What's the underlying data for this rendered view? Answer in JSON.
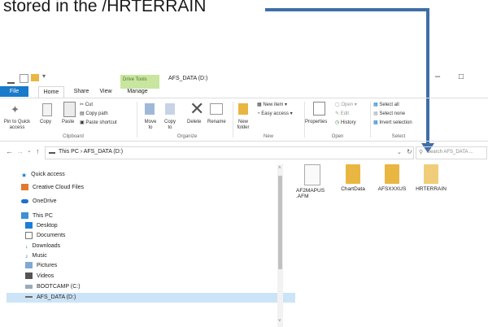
{
  "caption": "stored in the /HRTERRAIN",
  "colors": {
    "accent": "#3f6ea8",
    "file_tab": "#1979ca",
    "drive_tools": "#c8e6a0",
    "folder": "#e9b642"
  },
  "titlebar": {
    "context_tab": "Drive Tools",
    "title": "AFS_DATA (D:)",
    "minimize": "–",
    "maximize": "□"
  },
  "tabs": [
    "File",
    "Home",
    "Share",
    "View",
    "Manage"
  ],
  "ribbon": {
    "pin": "Pin to Quick access",
    "copy": "Copy",
    "paste": "Paste",
    "cut": "Cut",
    "copy_path": "Copy path",
    "paste_shortcut": "Paste shortcut",
    "clipboard": "Clipboard",
    "move_to": "Move to",
    "copy_to": "Copy to",
    "delete": "Delete",
    "rename": "Rename",
    "organize": "Organize",
    "new_item": "New item",
    "easy_access": "Easy access",
    "new_folder": "New folder",
    "new_group": "New",
    "properties": "Properties",
    "open": "Open",
    "edit": "Edit",
    "history": "History",
    "open_group": "Open",
    "select_all": "Select all",
    "select_none": "Select none",
    "invert_selection": "Invert selection",
    "select_group": "Select"
  },
  "address": {
    "path": "This PC  ›  AFS_DATA (D:)",
    "search_placeholder": "Search AFS_DATA ..."
  },
  "nav": [
    {
      "label": "Quick access",
      "icon": "star-icon"
    },
    {
      "label": "Creative Cloud Files",
      "icon": "cloud-folder-icon"
    },
    {
      "label": "OneDrive",
      "icon": "onedrive-icon"
    },
    {
      "label": "This PC",
      "icon": "pc-icon"
    },
    {
      "label": "Desktop",
      "icon": "desktop-icon"
    },
    {
      "label": "Documents",
      "icon": "documents-icon"
    },
    {
      "label": "Downloads",
      "icon": "downloads-icon"
    },
    {
      "label": "Music",
      "icon": "music-icon"
    },
    {
      "label": "Pictures",
      "icon": "pictures-icon"
    },
    {
      "label": "Videos",
      "icon": "videos-icon"
    },
    {
      "label": "BOOTCAMP (C:)",
      "icon": "drive-icon"
    },
    {
      "label": "AFS_DATA (D:)",
      "icon": "drive-icon"
    }
  ],
  "files": [
    {
      "name": "AF2MAPUS .AFM",
      "icon": "file-icon"
    },
    {
      "name": "ChartData",
      "icon": "folder-icon"
    },
    {
      "name": "AFSXXXUS",
      "icon": "folder-icon"
    },
    {
      "name": "HRTERRAIN",
      "icon": "folder-icon"
    }
  ]
}
